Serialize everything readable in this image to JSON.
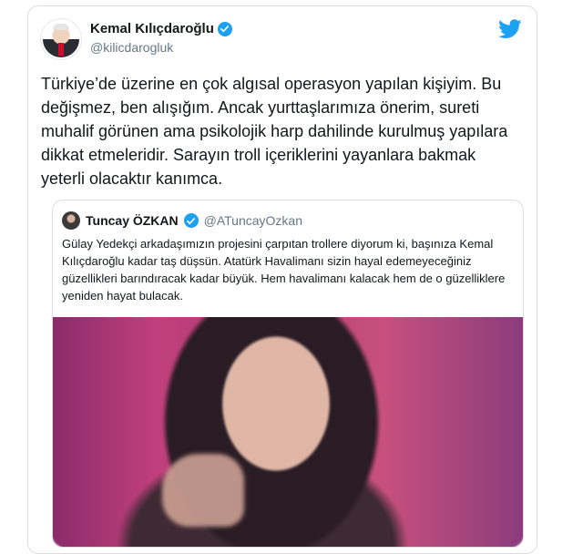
{
  "author": {
    "name": "Kemal Kılıçdaroğlu",
    "handle": "@kilicdarogluk"
  },
  "tweet": {
    "text": "Türkiye’de üzerine en çok algısal operasyon yapılan kişiyim. Bu değişmez, ben alışığım. Ancak yurttaşlarımıza önerim, sureti muhalif görünen ama psikolojik harp dahilinde kurulmuş yapılara dikkat etmeleridir. Sarayın troll içeriklerini yayanlara bakmak yeterli olacaktır kanımca."
  },
  "quote": {
    "name": "Tuncay ÖZKAN",
    "handle": "@ATuncayOzkan",
    "text": "Gülay Yedekçi arkadaşımızın projesini çarpıtan trollere diyorum ki, başınıza Kemal Kılıçdaroğlu kadar taş düşsün. Atatürk Havalimanı sizin hayal edemeyeceğiniz güzellikleri barındıracak kadar büyük. Hem havalimanı kalacak hem de o güzelliklere yeniden hayat bulacak."
  },
  "colors": {
    "twitter_blue": "#1da1f2",
    "text": "#14171a",
    "secondary": "#657786",
    "border": "#d9dde1"
  },
  "icons": {
    "brand": "twitter-bird-icon",
    "verified": "verified-badge-icon"
  }
}
